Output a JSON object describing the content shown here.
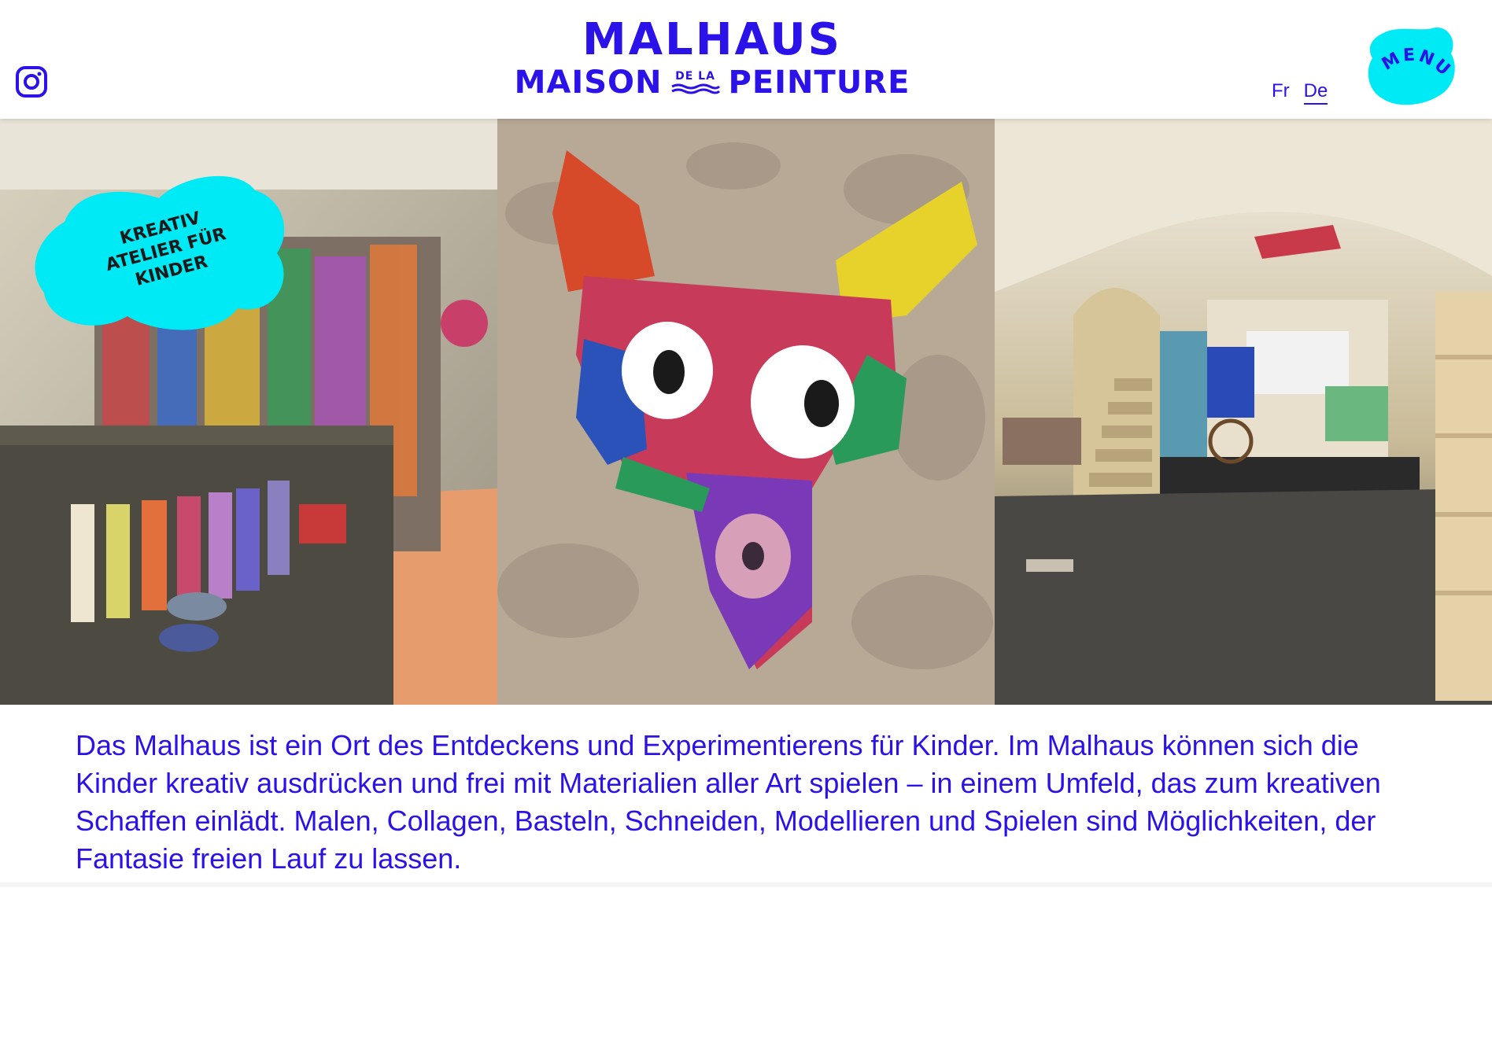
{
  "header": {
    "instagram_icon": "instagram-icon",
    "logo": {
      "line1": "MALHAUS",
      "line2_left": "MAISON",
      "line2_de": "DE",
      "line2_la": "LA",
      "line2_right": "PEINTURE"
    },
    "languages": [
      {
        "label": "Fr",
        "active": false
      },
      {
        "label": "De",
        "active": true
      }
    ],
    "menu_label": "MENU"
  },
  "badge": {
    "line1": "KREATIV",
    "line2": "ATELIER FÜR",
    "line3": "KINDER"
  },
  "gallery": {
    "photos": [
      "atelier-paint-shelf-photo",
      "cardboard-mask-photo",
      "vaulted-cellar-photo"
    ]
  },
  "intro": {
    "text": "Das Malhaus ist ein Ort des Entdeckens und Experimentierens für Kinder. Im Malhaus können sich die Kinder kreativ ausdrücken und frei mit Materialien aller Art spielen – in einem Umfeld, das zum kreativen Schaffen einlädt. Malen, Collagen, Basteln, Schneiden, Modellieren und Spielen sind Möglichkeiten, der Fantasie freien Lauf zu lassen."
  },
  "colors": {
    "brand_blue": "#2a12e8",
    "accent_cyan": "#00eaf5"
  }
}
